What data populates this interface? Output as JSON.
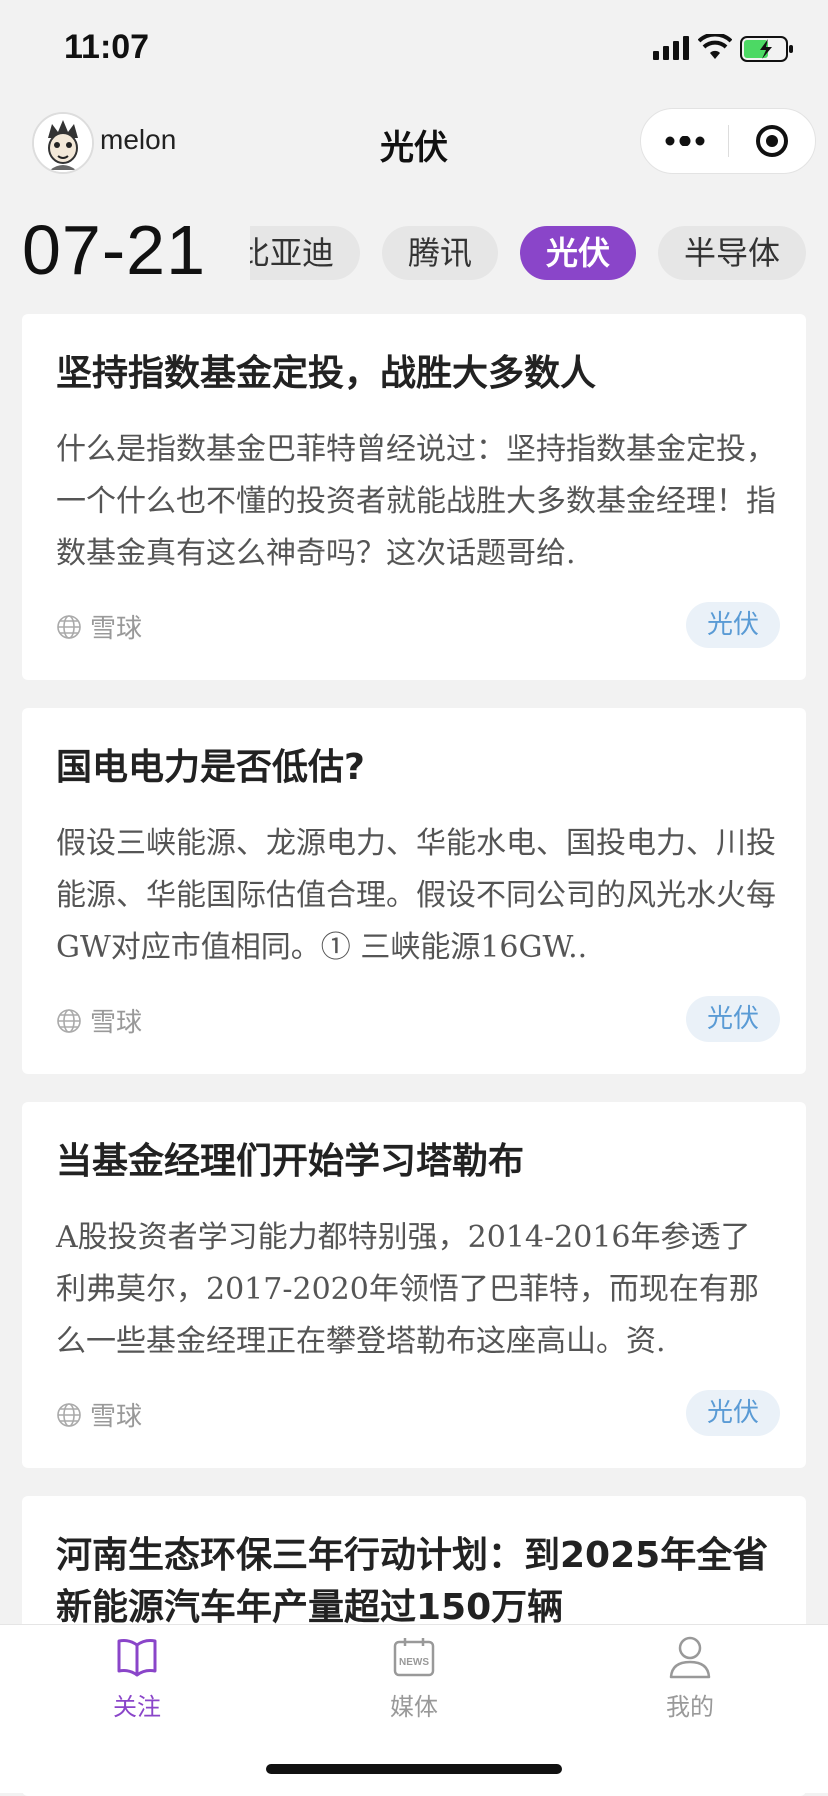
{
  "status_bar": {
    "time": "11:07"
  },
  "header": {
    "username": "melon",
    "title": "光伏"
  },
  "date": "07-21",
  "tabs": [
    {
      "label": "比亚迪",
      "active": false
    },
    {
      "label": "腾讯",
      "active": false
    },
    {
      "label": "光伏",
      "active": true
    },
    {
      "label": "半导体",
      "active": false
    }
  ],
  "cards": [
    {
      "title": "坚持指数基金定投，战胜大多数人",
      "summary": "什么是指数基金巴菲特曾经说过：坚持指数基金定投，一个什么也不懂的投资者就能战胜大多数基金经理！指数基金真有这么神奇吗？这次话题哥给.",
      "source": "雪球",
      "tag": "光伏"
    },
    {
      "title": "国电电力是否低估?",
      "summary": "假设三峡能源、龙源电力、华能水电、国投电力、川投能源、华能国际估值合理。假设不同公司的风光水火每GW对应市值相同。① 三峡能源16GW..",
      "source": "雪球",
      "tag": "光伏"
    },
    {
      "title": "当基金经理们开始学习塔勒布",
      "summary": "A股投资者学习能力都特别强，2014-2016年参透了利弗莫尔，2017-2020年领悟了巴菲特，而现在有那么一些基金经理正在攀登塔勒布这座高山。资.",
      "source": "雪球",
      "tag": "光伏"
    },
    {
      "title": "河南生态环保三年行动计划：到2025年全省新能源汽车年产量超过150万辆",
      "summary": "",
      "source": "",
      "tag": ""
    }
  ],
  "tabbar": {
    "items": [
      {
        "label": "关注",
        "icon": "book-icon",
        "active": true
      },
      {
        "label": "媒体",
        "icon": "news-icon",
        "active": false
      },
      {
        "label": "我的",
        "icon": "user-icon",
        "active": false
      }
    ]
  },
  "colors": {
    "accent": "#8a45c9",
    "tag_text": "#5a9bd5",
    "tag_bg": "#eaf1f8"
  }
}
